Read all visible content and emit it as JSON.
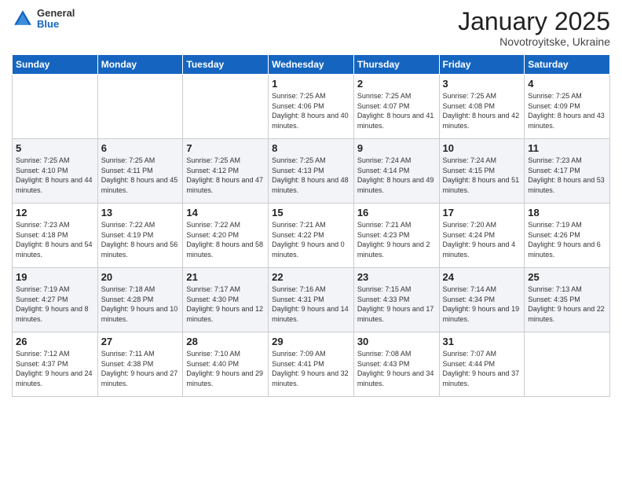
{
  "header": {
    "logo": {
      "general": "General",
      "blue": "Blue"
    },
    "title": "January 2025",
    "location": "Novotroyitske, Ukraine"
  },
  "weekdays": [
    "Sunday",
    "Monday",
    "Tuesday",
    "Wednesday",
    "Thursday",
    "Friday",
    "Saturday"
  ],
  "weeks": [
    [
      {
        "day": "",
        "sunrise": "",
        "sunset": "",
        "daylight": ""
      },
      {
        "day": "",
        "sunrise": "",
        "sunset": "",
        "daylight": ""
      },
      {
        "day": "",
        "sunrise": "",
        "sunset": "",
        "daylight": ""
      },
      {
        "day": "1",
        "sunrise": "Sunrise: 7:25 AM",
        "sunset": "Sunset: 4:06 PM",
        "daylight": "Daylight: 8 hours and 40 minutes."
      },
      {
        "day": "2",
        "sunrise": "Sunrise: 7:25 AM",
        "sunset": "Sunset: 4:07 PM",
        "daylight": "Daylight: 8 hours and 41 minutes."
      },
      {
        "day": "3",
        "sunrise": "Sunrise: 7:25 AM",
        "sunset": "Sunset: 4:08 PM",
        "daylight": "Daylight: 8 hours and 42 minutes."
      },
      {
        "day": "4",
        "sunrise": "Sunrise: 7:25 AM",
        "sunset": "Sunset: 4:09 PM",
        "daylight": "Daylight: 8 hours and 43 minutes."
      }
    ],
    [
      {
        "day": "5",
        "sunrise": "Sunrise: 7:25 AM",
        "sunset": "Sunset: 4:10 PM",
        "daylight": "Daylight: 8 hours and 44 minutes."
      },
      {
        "day": "6",
        "sunrise": "Sunrise: 7:25 AM",
        "sunset": "Sunset: 4:11 PM",
        "daylight": "Daylight: 8 hours and 45 minutes."
      },
      {
        "day": "7",
        "sunrise": "Sunrise: 7:25 AM",
        "sunset": "Sunset: 4:12 PM",
        "daylight": "Daylight: 8 hours and 47 minutes."
      },
      {
        "day": "8",
        "sunrise": "Sunrise: 7:25 AM",
        "sunset": "Sunset: 4:13 PM",
        "daylight": "Daylight: 8 hours and 48 minutes."
      },
      {
        "day": "9",
        "sunrise": "Sunrise: 7:24 AM",
        "sunset": "Sunset: 4:14 PM",
        "daylight": "Daylight: 8 hours and 49 minutes."
      },
      {
        "day": "10",
        "sunrise": "Sunrise: 7:24 AM",
        "sunset": "Sunset: 4:15 PM",
        "daylight": "Daylight: 8 hours and 51 minutes."
      },
      {
        "day": "11",
        "sunrise": "Sunrise: 7:23 AM",
        "sunset": "Sunset: 4:17 PM",
        "daylight": "Daylight: 8 hours and 53 minutes."
      }
    ],
    [
      {
        "day": "12",
        "sunrise": "Sunrise: 7:23 AM",
        "sunset": "Sunset: 4:18 PM",
        "daylight": "Daylight: 8 hours and 54 minutes."
      },
      {
        "day": "13",
        "sunrise": "Sunrise: 7:22 AM",
        "sunset": "Sunset: 4:19 PM",
        "daylight": "Daylight: 8 hours and 56 minutes."
      },
      {
        "day": "14",
        "sunrise": "Sunrise: 7:22 AM",
        "sunset": "Sunset: 4:20 PM",
        "daylight": "Daylight: 8 hours and 58 minutes."
      },
      {
        "day": "15",
        "sunrise": "Sunrise: 7:21 AM",
        "sunset": "Sunset: 4:22 PM",
        "daylight": "Daylight: 9 hours and 0 minutes."
      },
      {
        "day": "16",
        "sunrise": "Sunrise: 7:21 AM",
        "sunset": "Sunset: 4:23 PM",
        "daylight": "Daylight: 9 hours and 2 minutes."
      },
      {
        "day": "17",
        "sunrise": "Sunrise: 7:20 AM",
        "sunset": "Sunset: 4:24 PM",
        "daylight": "Daylight: 9 hours and 4 minutes."
      },
      {
        "day": "18",
        "sunrise": "Sunrise: 7:19 AM",
        "sunset": "Sunset: 4:26 PM",
        "daylight": "Daylight: 9 hours and 6 minutes."
      }
    ],
    [
      {
        "day": "19",
        "sunrise": "Sunrise: 7:19 AM",
        "sunset": "Sunset: 4:27 PM",
        "daylight": "Daylight: 9 hours and 8 minutes."
      },
      {
        "day": "20",
        "sunrise": "Sunrise: 7:18 AM",
        "sunset": "Sunset: 4:28 PM",
        "daylight": "Daylight: 9 hours and 10 minutes."
      },
      {
        "day": "21",
        "sunrise": "Sunrise: 7:17 AM",
        "sunset": "Sunset: 4:30 PM",
        "daylight": "Daylight: 9 hours and 12 minutes."
      },
      {
        "day": "22",
        "sunrise": "Sunrise: 7:16 AM",
        "sunset": "Sunset: 4:31 PM",
        "daylight": "Daylight: 9 hours and 14 minutes."
      },
      {
        "day": "23",
        "sunrise": "Sunrise: 7:15 AM",
        "sunset": "Sunset: 4:33 PM",
        "daylight": "Daylight: 9 hours and 17 minutes."
      },
      {
        "day": "24",
        "sunrise": "Sunrise: 7:14 AM",
        "sunset": "Sunset: 4:34 PM",
        "daylight": "Daylight: 9 hours and 19 minutes."
      },
      {
        "day": "25",
        "sunrise": "Sunrise: 7:13 AM",
        "sunset": "Sunset: 4:35 PM",
        "daylight": "Daylight: 9 hours and 22 minutes."
      }
    ],
    [
      {
        "day": "26",
        "sunrise": "Sunrise: 7:12 AM",
        "sunset": "Sunset: 4:37 PM",
        "daylight": "Daylight: 9 hours and 24 minutes."
      },
      {
        "day": "27",
        "sunrise": "Sunrise: 7:11 AM",
        "sunset": "Sunset: 4:38 PM",
        "daylight": "Daylight: 9 hours and 27 minutes."
      },
      {
        "day": "28",
        "sunrise": "Sunrise: 7:10 AM",
        "sunset": "Sunset: 4:40 PM",
        "daylight": "Daylight: 9 hours and 29 minutes."
      },
      {
        "day": "29",
        "sunrise": "Sunrise: 7:09 AM",
        "sunset": "Sunset: 4:41 PM",
        "daylight": "Daylight: 9 hours and 32 minutes."
      },
      {
        "day": "30",
        "sunrise": "Sunrise: 7:08 AM",
        "sunset": "Sunset: 4:43 PM",
        "daylight": "Daylight: 9 hours and 34 minutes."
      },
      {
        "day": "31",
        "sunrise": "Sunrise: 7:07 AM",
        "sunset": "Sunset: 4:44 PM",
        "daylight": "Daylight: 9 hours and 37 minutes."
      },
      {
        "day": "",
        "sunrise": "",
        "sunset": "",
        "daylight": ""
      }
    ]
  ]
}
